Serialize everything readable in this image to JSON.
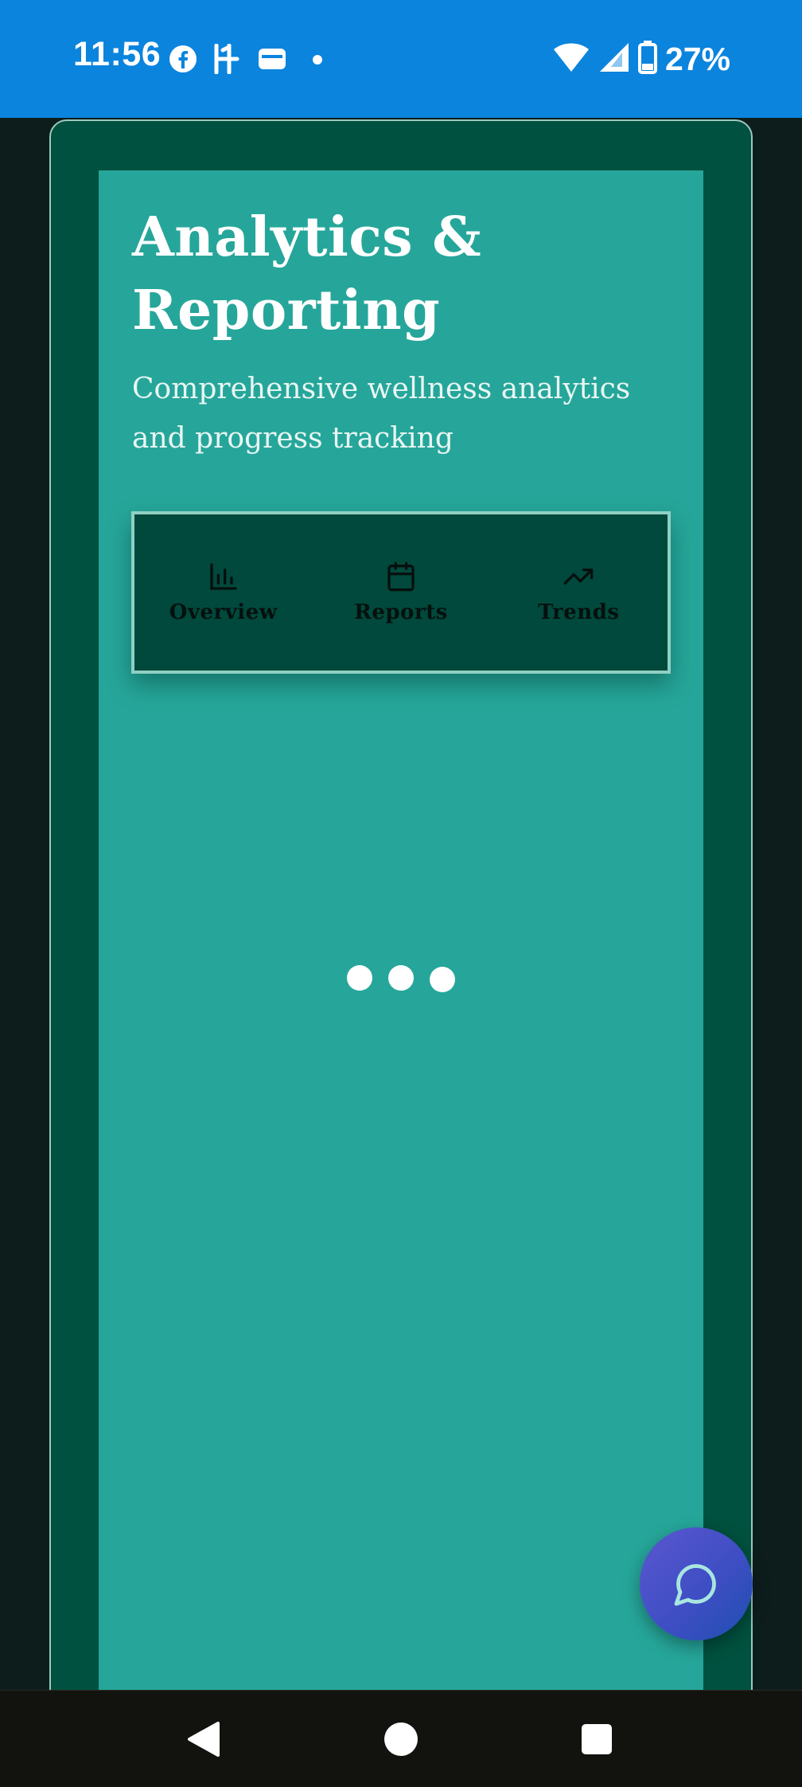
{
  "status_bar": {
    "time": "11:56",
    "battery_percent": "27%",
    "icons": [
      "facebook-icon",
      "h-app-icon",
      "wallet-icon",
      "notification-dot-icon",
      "wifi-icon",
      "cellular-signal-icon",
      "battery-icon"
    ],
    "background_color": "#0b84de"
  },
  "page": {
    "title": "Analytics & Reporting",
    "subtitle": "Comprehensive wellness analytics and progress tracking"
  },
  "tabs": [
    {
      "label": "Overview",
      "icon": "bar-chart-icon"
    },
    {
      "label": "Reports",
      "icon": "calendar-icon"
    },
    {
      "label": "Trends",
      "icon": "trending-up-icon"
    }
  ],
  "loading": {
    "dot_count": 3
  },
  "chat_button": {
    "icon": "chat-bubble-icon"
  },
  "nav_bar": {
    "buttons": [
      "back-icon",
      "home-icon",
      "recents-icon"
    ]
  },
  "colors": {
    "frame": "#00513f",
    "panel": "#26a69a",
    "tab_bar": "#00493c",
    "background": "#0d1d1c",
    "fab_gradient_start": "#5b57d0",
    "fab_gradient_end": "#1f4fb0"
  }
}
